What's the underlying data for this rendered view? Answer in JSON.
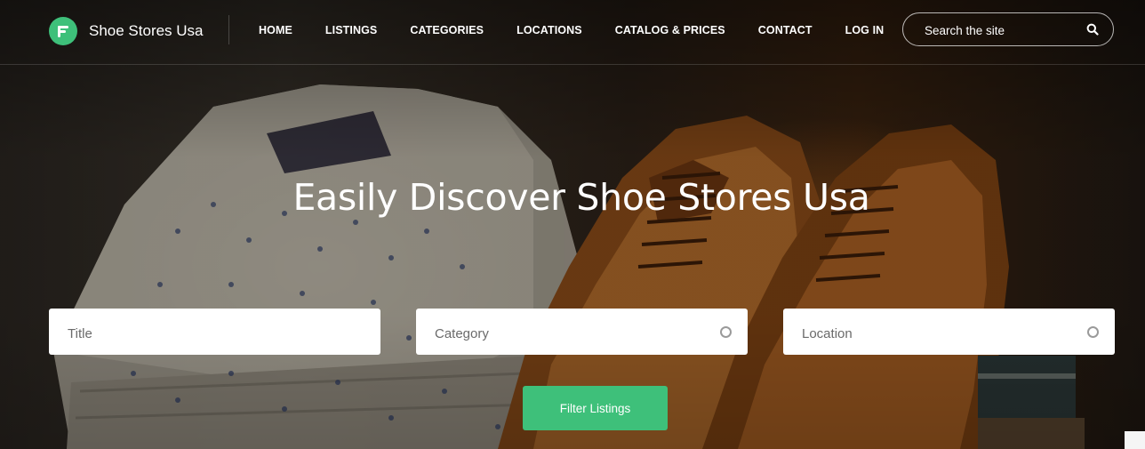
{
  "brand": {
    "name": "Shoe Stores Usa",
    "accent": "#3ec07a"
  },
  "nav": {
    "items": [
      "HOME",
      "LISTINGS",
      "CATEGORIES",
      "LOCATIONS",
      "CATALOG & PRICES",
      "CONTACT",
      "LOG IN"
    ]
  },
  "search": {
    "placeholder": "Search the site",
    "icon": "search-icon"
  },
  "hero": {
    "headline": "Easily Discover Shoe Stores Usa",
    "background": "photo of folded patterned shirts and brown leather oxford shoes"
  },
  "filters": {
    "title_placeholder": "Title",
    "category_placeholder": "Category",
    "location_placeholder": "Location",
    "button_label": "Filter Listings"
  }
}
